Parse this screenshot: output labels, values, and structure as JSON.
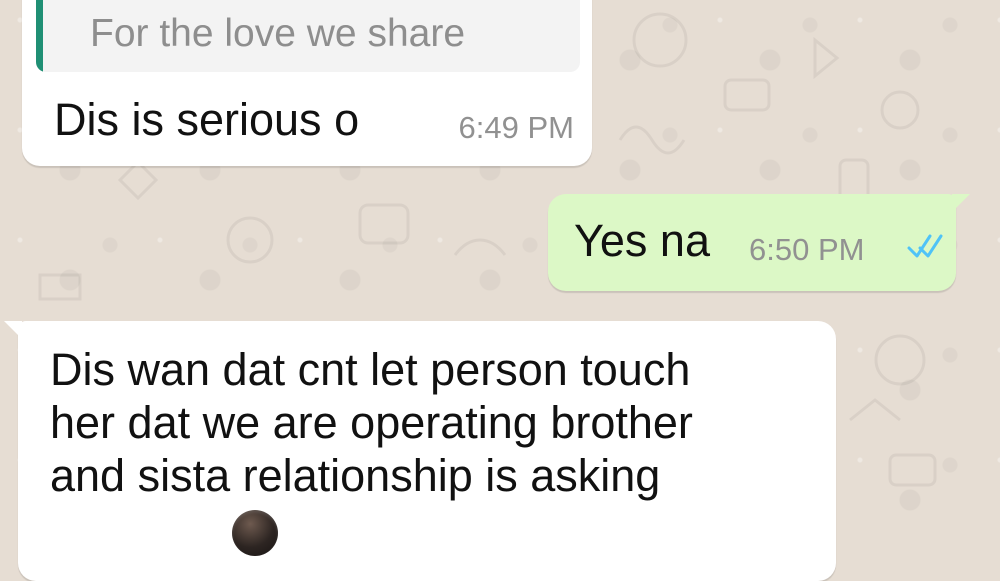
{
  "chat": {
    "messages": [
      {
        "direction": "incoming",
        "quoted_text": "For the love we share",
        "text": "Dis is serious o",
        "time": "6:49 PM"
      },
      {
        "direction": "outgoing",
        "text": "Yes na",
        "time": "6:50 PM",
        "status_icon": "double-check-icon"
      },
      {
        "direction": "incoming",
        "lines": [
          "Dis wan dat cnt let person touch",
          "her dat we are operating brother",
          "and sista relationship is asking"
        ]
      }
    ]
  },
  "colors": {
    "background": "#e6ddd3",
    "incoming_bubble": "#ffffff",
    "outgoing_bubble": "#dcf8c6",
    "quote_accent": "#1f8f74",
    "read_tick": "#4fc3f7"
  }
}
